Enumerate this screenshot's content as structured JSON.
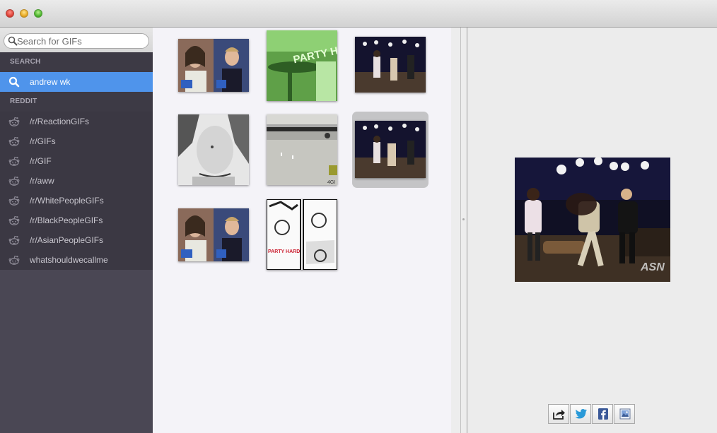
{
  "window": {
    "buttons": [
      "close",
      "minimize",
      "zoom"
    ]
  },
  "search": {
    "placeholder": "Search for GIFs",
    "value": ""
  },
  "sidebar": {
    "search_section": {
      "header": "SEARCH",
      "items": [
        {
          "label": "andrew wk",
          "icon": "search-icon",
          "selected": true
        }
      ]
    },
    "reddit_section": {
      "header": "REDDIT",
      "items": [
        {
          "label": "/r/ReactionGIFs",
          "icon": "reddit-alien-icon"
        },
        {
          "label": "/r/GIFs",
          "icon": "reddit-alien-icon"
        },
        {
          "label": "/r/GIF",
          "icon": "reddit-alien-icon"
        },
        {
          "label": "/r/aww",
          "icon": "reddit-alien-icon"
        },
        {
          "label": "/r/WhitePeopleGIFs",
          "icon": "reddit-alien-icon"
        },
        {
          "label": "/r/BlackPeopleGIFs",
          "icon": "reddit-alien-icon"
        },
        {
          "label": "/r/AsianPeopleGIFs",
          "icon": "reddit-alien-icon"
        },
        {
          "label": "whatshouldwecallme",
          "icon": "reddit-alien-icon"
        }
      ]
    }
  },
  "thumbnails": [
    {
      "subject": "two men talk show split screen",
      "text": ""
    },
    {
      "subject": "green tinted party scene",
      "text": "PARTY HA"
    },
    {
      "subject": "stage performance dark",
      "text": ""
    },
    {
      "subject": "shirtless man black and white",
      "text": ""
    },
    {
      "subject": "race track motorcycle",
      "text": "4GI"
    },
    {
      "subject": "stage performance dark",
      "text": "",
      "selected": true
    },
    {
      "subject": "two men talk show split screen",
      "text": ""
    },
    {
      "subject": "black and white comic panels",
      "text": "PARTY HARD"
    }
  ],
  "preview": {
    "subject": "talk show stage dancing",
    "watermark": "ASN"
  },
  "share_buttons": [
    {
      "name": "share-icon"
    },
    {
      "name": "twitter-icon"
    },
    {
      "name": "facebook-icon"
    },
    {
      "name": "photo-icon"
    }
  ],
  "colors": {
    "sidebar_bg": "#4a4754",
    "section_header_bg": "#3d3a45",
    "selection_blue": "#4f94eb",
    "grid_bg": "#f4f3f8"
  }
}
